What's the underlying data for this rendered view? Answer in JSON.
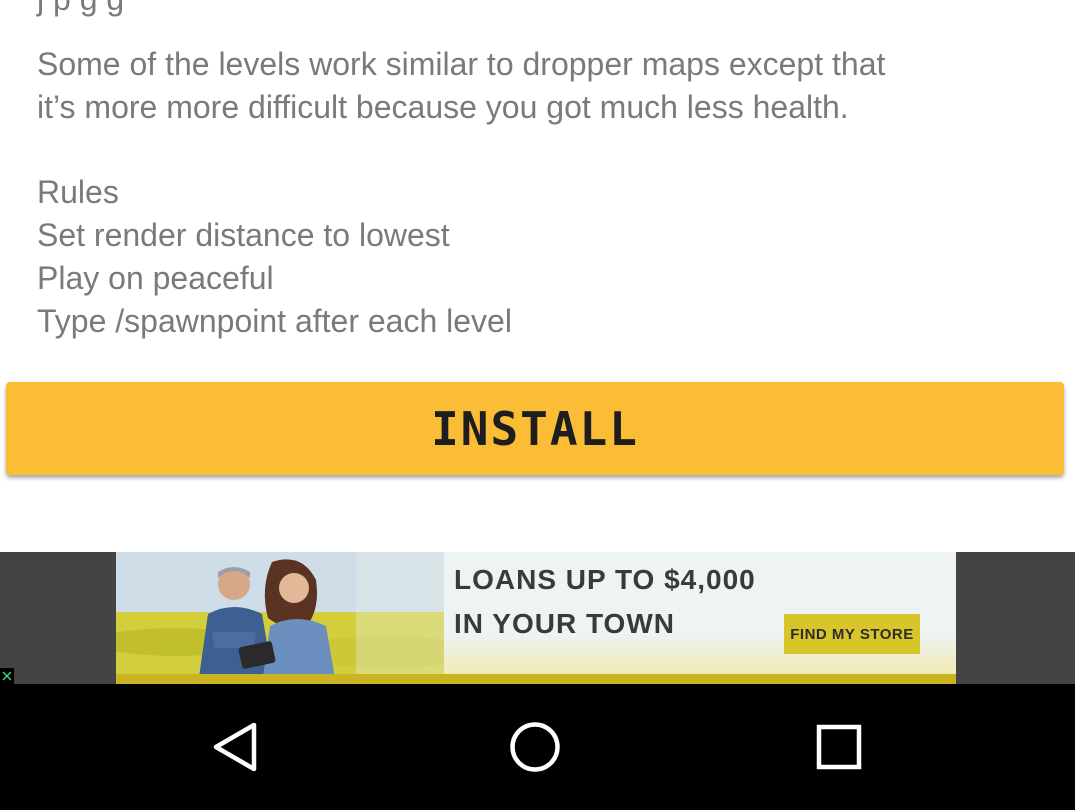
{
  "description": {
    "cut_line": "j   p        g       g   ",
    "paragraph_line_1": "Some of the levels work similar to dropper maps except that",
    "paragraph_line_2": "it’s more more difficult because you got much less health."
  },
  "rules": {
    "heading": "Rules",
    "items": [
      "Set render distance to lowest",
      "Play on peaceful",
      "Type /spawnpoint after each level"
    ]
  },
  "install_button": {
    "label": "INSTALL",
    "color": "#fbbc36"
  },
  "ad": {
    "headline_line_1": "LOANS UP TO $4,000",
    "headline_line_2": "IN YOUR TOWN",
    "cta_label": "FIND MY STORE"
  },
  "navigation": {
    "back_icon": "back-triangle-icon",
    "home_icon": "home-circle-icon",
    "recents_icon": "recents-square-icon"
  }
}
